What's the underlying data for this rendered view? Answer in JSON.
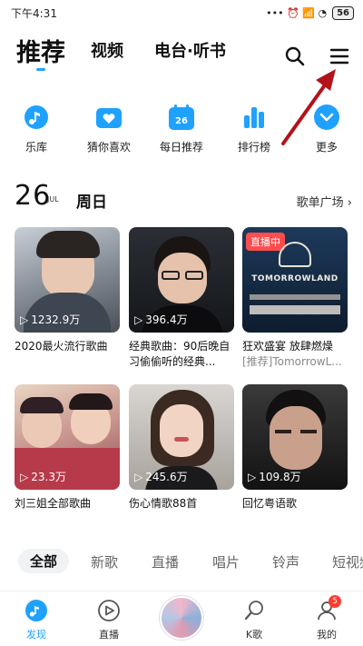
{
  "status": {
    "time": "下午4:31",
    "icons": "••• ⏰ 📶 ◔",
    "battery": "56"
  },
  "nav": {
    "tabs": [
      {
        "label": "推荐",
        "active": true
      },
      {
        "label": "视频"
      },
      {
        "label": "电台·听书"
      }
    ],
    "search_icon": "search-icon",
    "menu_icon": "hamburger-menu-icon"
  },
  "quick": [
    {
      "label": "乐库",
      "icon": "music-note-icon"
    },
    {
      "label": "猜你喜欢",
      "icon": "heart-box-icon"
    },
    {
      "label": "每日推荐",
      "icon": "calendar-icon",
      "day": "26"
    },
    {
      "label": "排行榜",
      "icon": "bar-chart-icon"
    },
    {
      "label": "更多",
      "icon": "more-chevron-icon"
    }
  ],
  "date": {
    "day": "26",
    "month": "JUL",
    "weekday": "周日",
    "plaza": "歌单广场 ›"
  },
  "cards": [
    {
      "count": "1232.9万",
      "title": "2020最火流行歌曲",
      "sub": ""
    },
    {
      "count": "396.4万",
      "title": "经典歌曲：90后晚自习偷偷听的经典...",
      "sub": ""
    },
    {
      "live": "直播中",
      "cover_text": "TOMORROWLAND",
      "count": "",
      "title": "狂欢盛宴 放肆燃燥",
      "sub": "[推荐]TomorrowL..."
    },
    {
      "count": "23.3万",
      "title": "刘三姐全部歌曲",
      "sub": ""
    },
    {
      "count": "245.6万",
      "title": "伤心情歌88首",
      "sub": ""
    },
    {
      "count": "109.8万",
      "title": "回忆粤语歌",
      "sub": ""
    }
  ],
  "categories": [
    "全部",
    "新歌",
    "直播",
    "唱片",
    "铃声",
    "短视频"
  ],
  "bottom": [
    {
      "label": "发现",
      "active": true,
      "icon": "discover-icon"
    },
    {
      "label": "直播",
      "icon": "play-circle-icon"
    },
    {
      "label": "K歌",
      "icon": "karaoke-icon"
    },
    {
      "label": "我的",
      "icon": "profile-icon",
      "badge": "5"
    }
  ],
  "colors": {
    "accent": "#1fa1ff",
    "badge": "#ff3b30"
  }
}
